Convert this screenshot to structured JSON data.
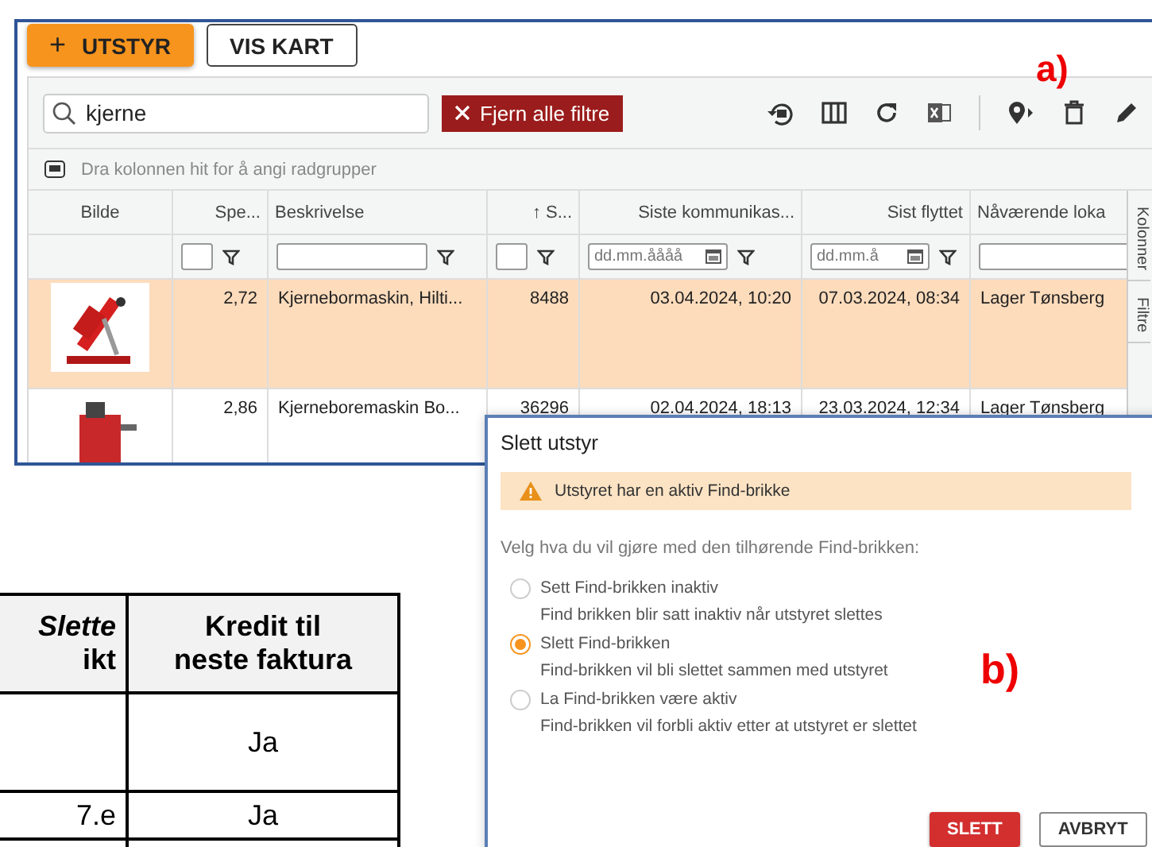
{
  "equipment_screen": {
    "buttons": [
      {
        "label": "UTSTYR",
        "icon": "+",
        "kind": "primary"
      },
      {
        "label": "VIS KART",
        "kind": "outlined"
      }
    ],
    "search": {
      "value": "kjerne"
    },
    "clear_filters": "Fjern alle filtre",
    "group_hint": "Dra kolonnen hit for å angi radgrupper",
    "columns": [
      {
        "label": "Bilde"
      },
      {
        "label": "Spe..."
      },
      {
        "label": "Beskrivelse"
      },
      {
        "label": "↑ S..."
      },
      {
        "label": "Siste kommunikas..."
      },
      {
        "label": "Sist flyttet"
      },
      {
        "label": "Nåværende loka"
      }
    ],
    "filters": [
      {
        "kind": "none"
      },
      {
        "kind": "number"
      },
      {
        "kind": "text"
      },
      {
        "kind": "number"
      },
      {
        "kind": "date",
        "placeholder": "dd.mm.åååå"
      },
      {
        "kind": "date",
        "placeholder": "dd.mm.å"
      },
      {
        "kind": "text"
      }
    ],
    "rows": [
      {
        "selected": true,
        "cells": [
          {
            "kind": "picture"
          },
          "2,72",
          "Kjernebormaskin, Hilti...",
          "8488",
          "03.04.2024, 10:20",
          "07.03.2024, 08:34",
          "Lager Tønsberg"
        ]
      },
      {
        "selected": false,
        "cells": [
          {
            "kind": "picture"
          },
          "2,86",
          "Kjerneboremaskin Bo...",
          "36296",
          "02.04.2024, 18:13",
          "23.03.2024, 12:34",
          "Lager Tønsberg"
        ]
      }
    ],
    "side_tabs": [
      "Kolonner",
      "Filtre"
    ],
    "callout": "a)"
  },
  "document_table": {
    "header": [
      [
        "*Slette*",
        "ikt"
      ],
      [
        "Kredit til",
        "neste faktura"
      ]
    ],
    "rows": [
      [
        null,
        "Ja"
      ],
      [
        "7.e",
        "Ja"
      ],
      [
        null,
        null
      ]
    ]
  },
  "delete_dialog": {
    "title": "Slett utstyr",
    "warning": "Utstyret har en aktiv Find-brikke",
    "prompt": "Velg hva du vil gjøre med den tilhørende Find-brikken:",
    "options": [
      {
        "label": "Sett Find-brikken inaktiv",
        "description": "Find brikken blir satt inaktiv når utstyret slettes",
        "selected": false
      },
      {
        "label": "Slett Find-brikken",
        "description": "Find-brikken vil bli slettet sammen med utstyret",
        "selected": true
      },
      {
        "label": "La Find-brikken være aktiv",
        "description": "Find-brikken vil forbli aktiv etter at utstyret er slettet",
        "selected": false
      }
    ],
    "buttons": [
      {
        "label": "SLETT",
        "kind": "danger"
      },
      {
        "label": "AVBRYT",
        "kind": "outlined"
      }
    ],
    "callout": "b)"
  }
}
